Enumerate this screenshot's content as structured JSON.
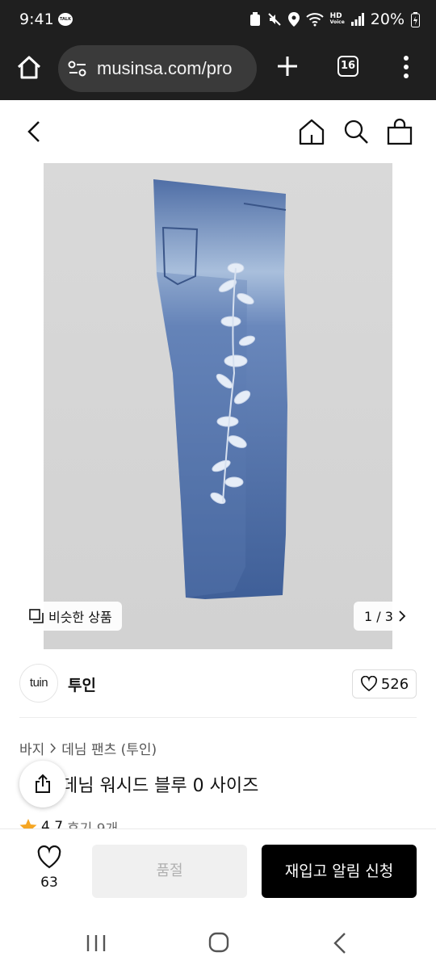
{
  "status_bar": {
    "time": "9:41",
    "notification_badge": "TALK",
    "network": "HD",
    "network_sub": "Voice",
    "battery": "20%"
  },
  "browser": {
    "url": "musinsa.com/pro",
    "tab_count": "16"
  },
  "gallery": {
    "similar_label": "비슷한 상품",
    "pager": "1 / 3"
  },
  "brand": {
    "logo_text": "tuin",
    "name": "투인",
    "like_count": "526"
  },
  "breadcrumb": {
    "category": "바지",
    "subcategory": "데님 팬츠 (투인)"
  },
  "product": {
    "title": "데님 워시드 블루 0 사이즈",
    "rating": "4.7",
    "review_text": "후기 9개"
  },
  "bottom_bar": {
    "wish_count": "63",
    "soldout_label": "품절",
    "restock_label": "재입고 알림 신청"
  },
  "colors": {
    "accent_star": "#f5a623",
    "primary_button": "#000000",
    "disabled_button": "#f0f0f0"
  }
}
